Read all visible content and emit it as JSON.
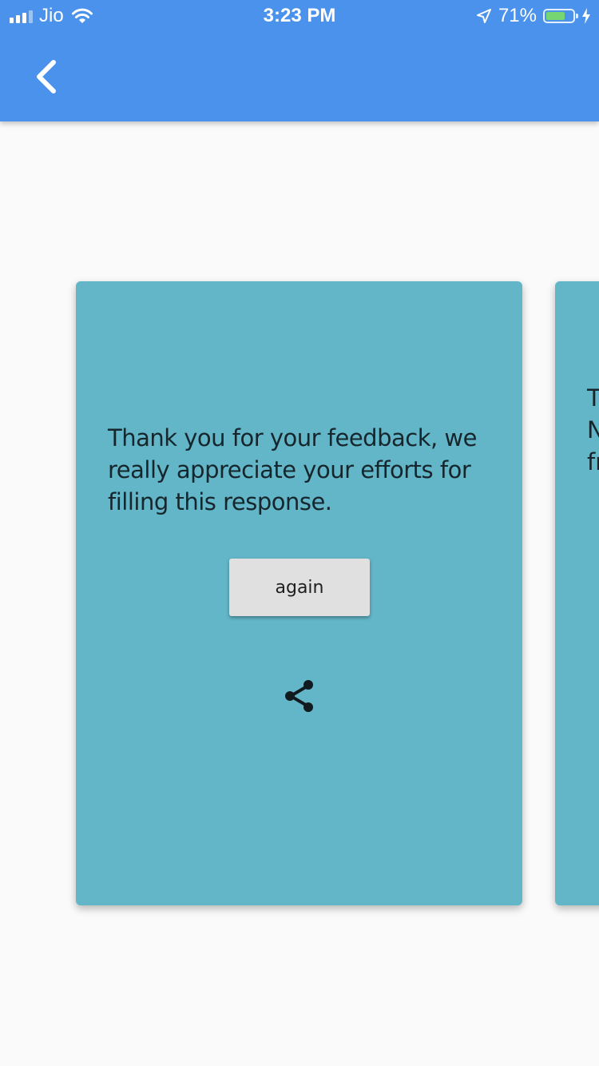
{
  "status_bar": {
    "carrier": "Jio",
    "time": "3:23 PM",
    "battery_percent": "71%",
    "battery_level": 0.71,
    "icons": [
      "signal-icon",
      "wifi-icon",
      "location-arrow-icon",
      "battery-icon",
      "charging-bolt-icon"
    ]
  },
  "app_bar": {
    "color": "#4a92eb",
    "back_icon": "chevron-left-icon"
  },
  "cards": {
    "main": {
      "message": "Thank you for your feedback, we really appreciate your efforts for filling this response.",
      "again_label": "again",
      "share_icon": "share-icon",
      "color": "#62b6c8"
    },
    "next_peek": {
      "text": "T\nN\nfr"
    }
  }
}
